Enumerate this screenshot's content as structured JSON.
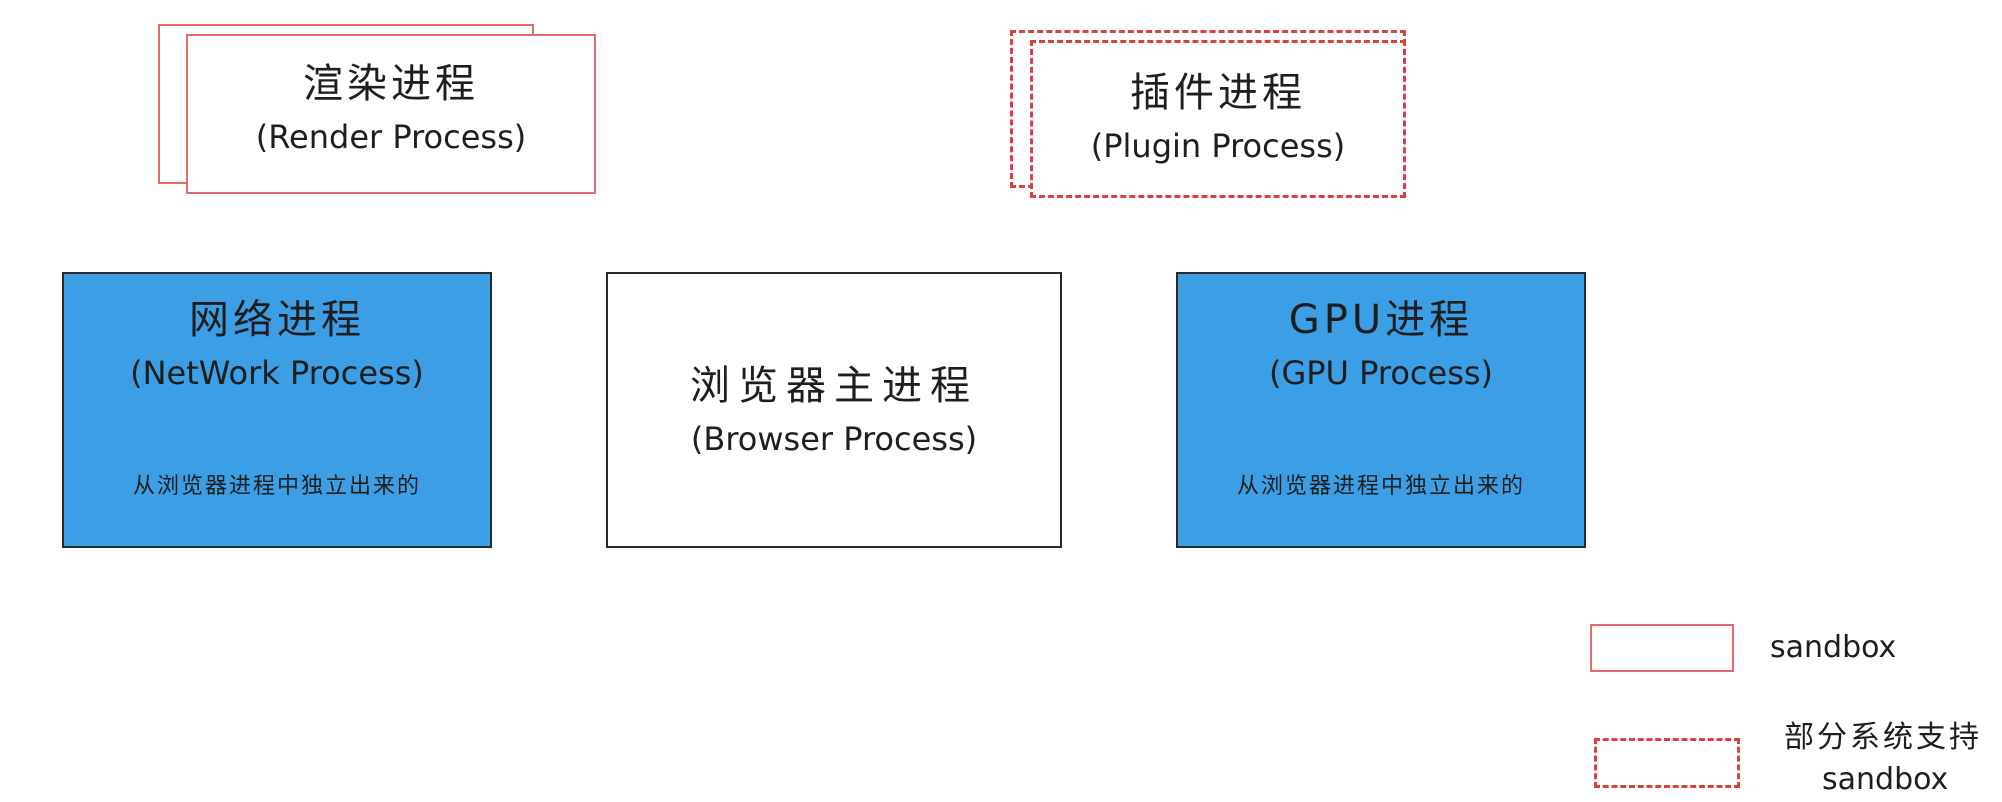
{
  "render_process": {
    "title": "渲染进程",
    "subtitle": "(Render Process)"
  },
  "plugin_process": {
    "title": "插件进程",
    "subtitle": "(Plugin Process)"
  },
  "network_process": {
    "title": "网络进程",
    "subtitle": "(NetWork Process)",
    "note": "从浏览器进程中独立出来的"
  },
  "browser_process": {
    "title": "浏览器主进程",
    "subtitle": "(Browser Process)"
  },
  "gpu_process": {
    "title": "GPU进程",
    "subtitle": "(GPU Process)",
    "note": "从浏览器进程中独立出来的"
  },
  "legend": {
    "solid_label": "sandbox",
    "dashed_label_line1": "部分系统支持",
    "dashed_label_line2": "sandbox"
  },
  "colors": {
    "sandbox_border": "#e06a6a",
    "partial_sandbox_border": "#d94040",
    "process_fill_blue": "#3c9ee4",
    "box_border": "#2a2a2a"
  }
}
